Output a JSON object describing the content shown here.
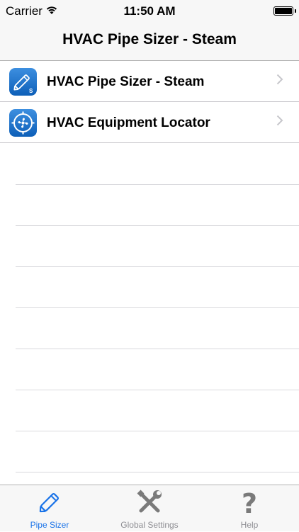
{
  "status_bar": {
    "carrier": "Carrier",
    "time": "11:50 AM"
  },
  "nav": {
    "title": "HVAC Pipe Sizer - Steam"
  },
  "list": {
    "items": [
      {
        "label": "HVAC Pipe Sizer - Steam",
        "icon": "pencil-s-icon"
      },
      {
        "label": "HVAC Equipment Locator",
        "icon": "fan-target-icon"
      }
    ]
  },
  "tabs": [
    {
      "label": "Pipe Sizer",
      "icon": "pencil-icon",
      "active": true
    },
    {
      "label": "Global Settings",
      "icon": "wrench-screwdriver-icon",
      "active": false
    },
    {
      "label": "Help",
      "icon": "question-icon",
      "active": false
    }
  ],
  "colors": {
    "accent": "#1a73e8",
    "inactive": "#8e8e93",
    "bar": "#f7f7f7",
    "icon_blue": "#1565c0"
  }
}
